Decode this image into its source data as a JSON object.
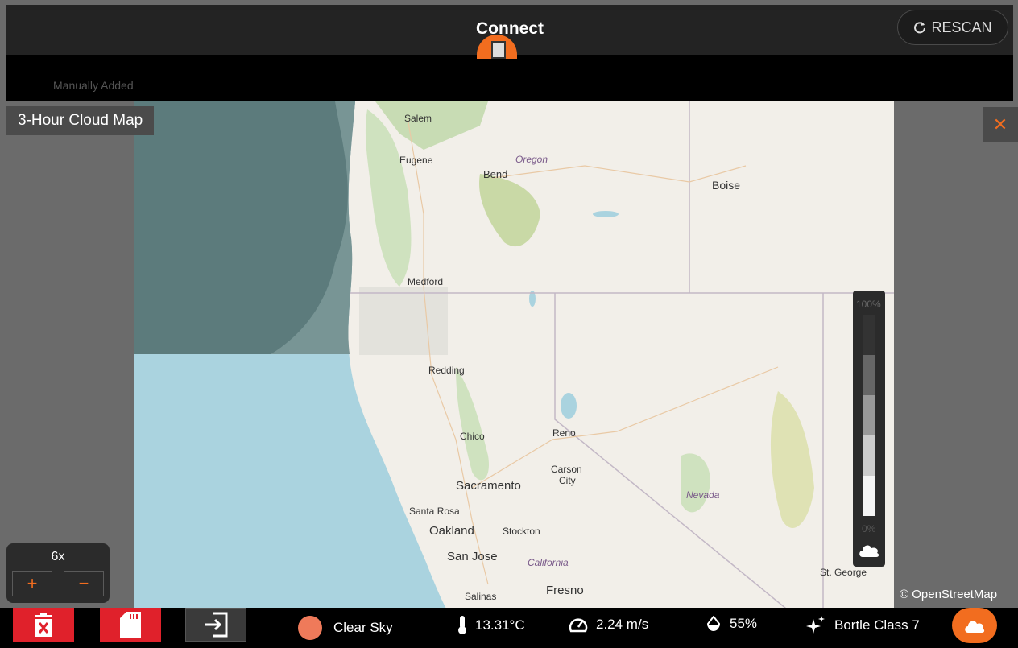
{
  "header": {
    "title": "Connect",
    "rescan_label": "RESCAN"
  },
  "subbar": {
    "manual_label": "Manually Added"
  },
  "cloud_map": {
    "title": "3-Hour Cloud Map",
    "legend": {
      "max_label": "100%",
      "min_label": "0%"
    },
    "attribution": "© OpenStreetMap"
  },
  "zoom": {
    "level": "6x",
    "plus": "+",
    "minus": "−"
  },
  "map_labels": {
    "salem": "Salem",
    "eugene": "Eugene",
    "oregon": "Oregon",
    "bend": "Bend",
    "boise": "Boise",
    "medford": "Medford",
    "redding": "Redding",
    "chico": "Chico",
    "reno": "Reno",
    "carson": "Carson",
    "city": "City",
    "sacramento": "Sacramento",
    "santa_rosa": "Santa Rosa",
    "oakland": "Oakland",
    "stockton": "Stockton",
    "san_jose": "San Jose",
    "california": "California",
    "salinas": "Salinas",
    "fresno": "Fresno",
    "nevada": "Nevada",
    "st_george": "St. George"
  },
  "status": {
    "sky": "Clear Sky",
    "temperature": "13.31°C",
    "wind": "2.24 m/s",
    "humidity": "55%",
    "bortle": "Bortle Class 7"
  },
  "colors": {
    "accent": "#f26d1f",
    "delete_red": "#e0212b",
    "sky_dot": "#ef7a5a"
  },
  "icons": {
    "delete": "delete-icon",
    "sd_card": "sd-card-icon",
    "exit": "exit-icon",
    "thermometer": "thermometer-icon",
    "speedometer": "speedometer-icon",
    "droplet": "droplet-icon",
    "sparkle": "sparkle-icon",
    "cloud": "cloud-icon"
  }
}
